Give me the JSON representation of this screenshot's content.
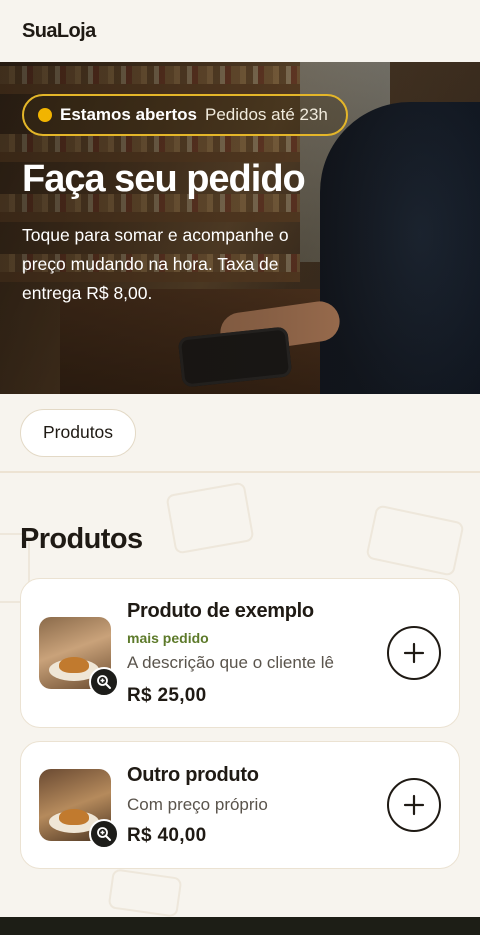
{
  "header": {
    "brand": "SuaLoja"
  },
  "hero": {
    "status_open": "Estamos abertos",
    "status_hours": "Pedidos até 23h",
    "title": "Faça seu pedido",
    "text": "Toque para somar e acompanhe o preço mudando na hora. Taxa de entrega R$ 8,00."
  },
  "filters": {
    "chips": [
      "Produtos"
    ]
  },
  "main": {
    "section_title": "Produtos",
    "products": [
      {
        "name": "Produto de exemplo",
        "tag": "mais pedido",
        "description": "A descrição que o cliente lê",
        "price": "R$ 25,00"
      },
      {
        "name": "Outro produto",
        "description": "Com preço próprio",
        "price": "R$ 40,00"
      }
    ]
  },
  "icons": {
    "zoom": "zoom-in-icon",
    "add": "plus-icon",
    "status": "status-dot-icon"
  },
  "colors": {
    "accent": "#e4b629",
    "status_dot": "#f2b400",
    "tag": "#5d7a2a",
    "text": "#1f1a14",
    "background": "#f7f4ee"
  }
}
